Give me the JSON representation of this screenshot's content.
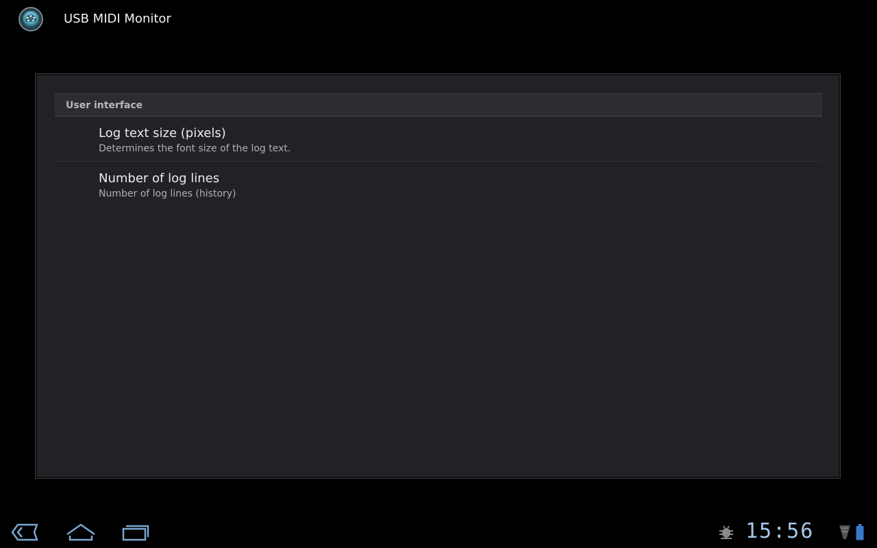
{
  "app": {
    "title": "USB MIDI Monitor",
    "icon": "midi-app-icon"
  },
  "preferences": {
    "category": "User interface",
    "items": [
      {
        "title": "Log text size (pixels)",
        "summary": "Determines the font size of the log text."
      },
      {
        "title": "Number of log lines",
        "summary": "Number of log lines (history)"
      }
    ]
  },
  "system_bar": {
    "nav": [
      "back-icon",
      "home-icon",
      "recent-apps-icon"
    ],
    "status_icons": [
      "debug-icon",
      "signal-icon",
      "battery-icon"
    ],
    "time": "15:56",
    "accent_color": "#a8c8e8"
  },
  "colors": {
    "background": "#000000",
    "panel": "#222226",
    "category_header": "#2c2c31"
  }
}
